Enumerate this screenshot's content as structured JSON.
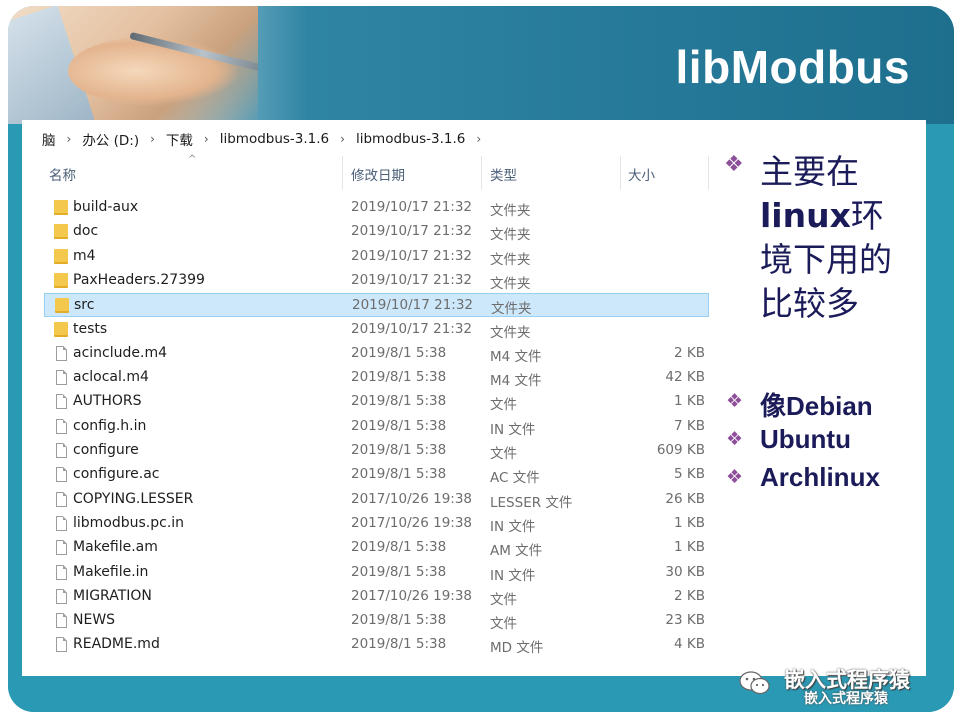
{
  "slide": {
    "title": "libModbus"
  },
  "explorer": {
    "breadcrumb": [
      "脑",
      "办公 (D:)",
      "下载",
      "libmodbus-3.1.6",
      "libmodbus-3.1.6"
    ],
    "columns": {
      "name": "名称",
      "date": "修改日期",
      "type": "类型",
      "size": "大小"
    },
    "selected_row": "src",
    "rows": [
      {
        "kind": "folder",
        "name": "build-aux",
        "date": "2019/10/17 21:32",
        "type": "文件夹",
        "size": ""
      },
      {
        "kind": "folder",
        "name": "doc",
        "date": "2019/10/17 21:32",
        "type": "文件夹",
        "size": ""
      },
      {
        "kind": "folder",
        "name": "m4",
        "date": "2019/10/17 21:32",
        "type": "文件夹",
        "size": ""
      },
      {
        "kind": "folder",
        "name": "PaxHeaders.27399",
        "date": "2019/10/17 21:32",
        "type": "文件夹",
        "size": ""
      },
      {
        "kind": "folder",
        "name": "src",
        "date": "2019/10/17 21:32",
        "type": "文件夹",
        "size": ""
      },
      {
        "kind": "folder",
        "name": "tests",
        "date": "2019/10/17 21:32",
        "type": "文件夹",
        "size": ""
      },
      {
        "kind": "file",
        "name": "acinclude.m4",
        "date": "2019/8/1 5:38",
        "type": "M4 文件",
        "size": "2 KB"
      },
      {
        "kind": "file",
        "name": "aclocal.m4",
        "date": "2019/8/1 5:38",
        "type": "M4 文件",
        "size": "42 KB"
      },
      {
        "kind": "file",
        "name": "AUTHORS",
        "date": "2019/8/1 5:38",
        "type": "文件",
        "size": "1 KB"
      },
      {
        "kind": "file",
        "name": "config.h.in",
        "date": "2019/8/1 5:38",
        "type": "IN 文件",
        "size": "7 KB"
      },
      {
        "kind": "file",
        "name": "configure",
        "date": "2019/8/1 5:38",
        "type": "文件",
        "size": "609 KB"
      },
      {
        "kind": "file",
        "name": "configure.ac",
        "date": "2019/8/1 5:38",
        "type": "AC 文件",
        "size": "5 KB"
      },
      {
        "kind": "file",
        "name": "COPYING.LESSER",
        "date": "2017/10/26 19:38",
        "type": "LESSER 文件",
        "size": "26 KB"
      },
      {
        "kind": "file",
        "name": "libmodbus.pc.in",
        "date": "2017/10/26 19:38",
        "type": "IN 文件",
        "size": "1 KB"
      },
      {
        "kind": "file",
        "name": "Makefile.am",
        "date": "2019/8/1 5:38",
        "type": "AM 文件",
        "size": "1 KB"
      },
      {
        "kind": "file",
        "name": "Makefile.in",
        "date": "2019/8/1 5:38",
        "type": "IN 文件",
        "size": "30 KB"
      },
      {
        "kind": "file",
        "name": "MIGRATION",
        "date": "2017/10/26 19:38",
        "type": "文件",
        "size": "2 KB"
      },
      {
        "kind": "file",
        "name": "NEWS",
        "date": "2019/8/1 5:38",
        "type": "文件",
        "size": "23 KB"
      },
      {
        "kind": "file",
        "name": "README.md",
        "date": "2019/8/1 5:38",
        "type": "MD 文件",
        "size": "4 KB"
      }
    ]
  },
  "bullets": {
    "main_line_1": "主要在",
    "main_line_2_bold": "linux",
    "main_line_2_rest": "环",
    "main_line_3": "境下用的",
    "main_line_4": "比较多",
    "sub": [
      "像Debian",
      "Ubuntu",
      "Archlinux"
    ],
    "glyph": "❖"
  },
  "watermark": {
    "line_1": "嵌入式程序猿",
    "line_2": "嵌入式程序猿"
  },
  "colors": {
    "frame": "#2a99b4",
    "header": "#1e6f8e",
    "bullet_glyph": "#8e4f9a",
    "bullet_text": "#1b1b5a",
    "selection": "#cde8fb",
    "folder": "#f3c84c"
  }
}
